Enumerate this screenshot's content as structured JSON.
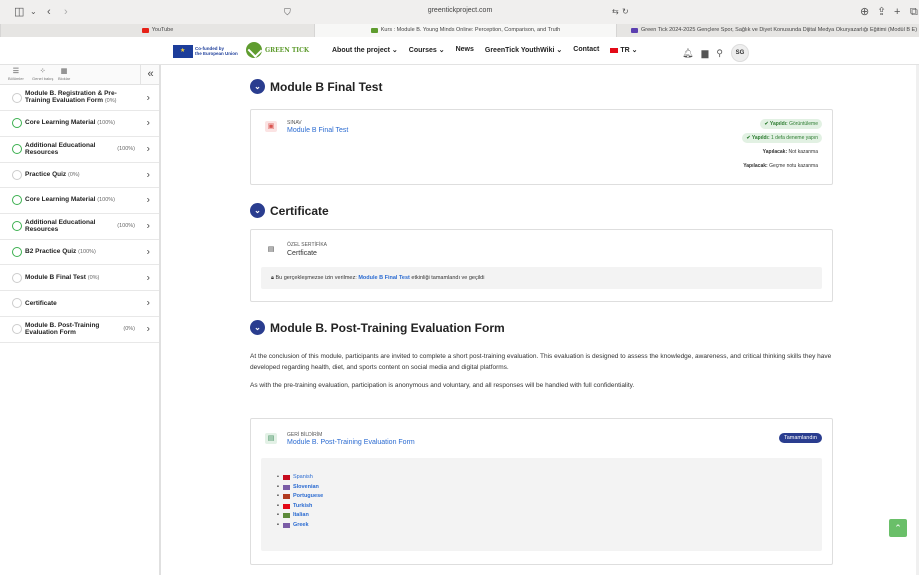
{
  "browser": {
    "url": "greentickproject.com",
    "tabs": [
      {
        "label": "YouTube",
        "fav_color": "#e62117"
      },
      {
        "label": "Kurs : Module B. Young Minds Online: Perception, Comparison, and Truth",
        "fav_color": "#5f9c2f"
      },
      {
        "label": "Green Tick 2024-2025 Gençlere Spor, Sağlık ve Diyet Konusunda Dijital Medya Okuryazarlığı Eğitimi (Modül B E)",
        "fav_color": "#5b3fb0"
      }
    ]
  },
  "header": {
    "eu_text_line1": "Co-funded by",
    "eu_text_line2": "the European Union",
    "logo_text": "GREEN TICK",
    "nav": [
      "About the project ⌄",
      "Courses ⌄",
      "News",
      "GreenTick YouthWiki ⌄",
      "Contact",
      "TR ⌄"
    ],
    "avatar": "SG"
  },
  "sidebar": {
    "mini_labels": [
      "Bölümler",
      "Genel bakış",
      "Bloklar"
    ],
    "items": [
      {
        "title": "Module B. Registration & Pre-Training Evaluation Form",
        "pct": "(0%)",
        "done": false
      },
      {
        "title": "Core Learning Material",
        "pct": "(100%)",
        "done": true
      },
      {
        "title": "Additional Educational Resources",
        "pct": "(100%)",
        "done": true
      },
      {
        "title": "Practice Quiz",
        "pct": "(0%)",
        "done": false
      },
      {
        "title": "Core Learning Material",
        "pct": "(100%)",
        "done": true
      },
      {
        "title": "Additional Educational Resources",
        "pct": "(100%)",
        "done": true
      },
      {
        "title": "B2 Practice Quiz",
        "pct": "(100%)",
        "done": true
      },
      {
        "title": "Module B Final Test",
        "pct": "(0%)",
        "done": false
      },
      {
        "title": "Certificate",
        "pct": "",
        "done": false
      },
      {
        "title": "Module B. Post-Training Evaluation Form",
        "pct": "(0%)",
        "done": false
      }
    ]
  },
  "main": {
    "final_test": {
      "heading": "Module B Final Test",
      "type": "SINAV",
      "link": "Module B Final Test",
      "statuses": [
        {
          "bold": "✔ Yapıldı:",
          "text": " Görüntüleme"
        },
        {
          "bold": "✔ Yapıldı:",
          "text": " 1 defa deneme yapın"
        },
        {
          "bold": "Yapılacak:",
          "text": " Not kazanma"
        },
        {
          "bold": "Yapılacak:",
          "text": " Geçme notu kazanma"
        }
      ]
    },
    "certificate": {
      "heading": "Certificate",
      "type": "ÖZEL SERTİFİKA",
      "name": "Certficate",
      "restriction_prefix": "Bu gerçekleşmezse izin verilmez: ",
      "restriction_link": "Module B Final Test",
      "restriction_suffix": " etkinliği tamamlandı ve geçildi"
    },
    "post_form": {
      "heading": "Module B. Post-Training Evaluation Form",
      "para1": "At the conclusion of this module, participants are invited to complete a short post-training evaluation. This evaluation is designed to assess the knowledge, awareness, and critical thinking skills they have developed regarding health, diet, and sports content on social media and digital platforms.",
      "para2": "As with the pre-training evaluation, participation is anonymous and voluntary, and all responses will be handled with full confidentiality.",
      "type": "GERİ BİLDİRİM",
      "link": "Module B. Post-Training Evaluation Form",
      "badge": "Tamamlandın",
      "languages": [
        {
          "name": "Spanish",
          "bold": false,
          "flag": "#c60b1e"
        },
        {
          "name": "Slovenian",
          "bold": true,
          "flag": "#7a5ca6"
        },
        {
          "name": "Portuguese",
          "bold": true,
          "flag": "#b13a1f"
        },
        {
          "name": "Turkish",
          "bold": true,
          "flag": "#e30a17"
        },
        {
          "name": "Italian",
          "bold": true,
          "flag": "#5c8a3a"
        },
        {
          "name": "Greek",
          "bold": true,
          "flag": "#7a5ca6"
        }
      ]
    }
  }
}
